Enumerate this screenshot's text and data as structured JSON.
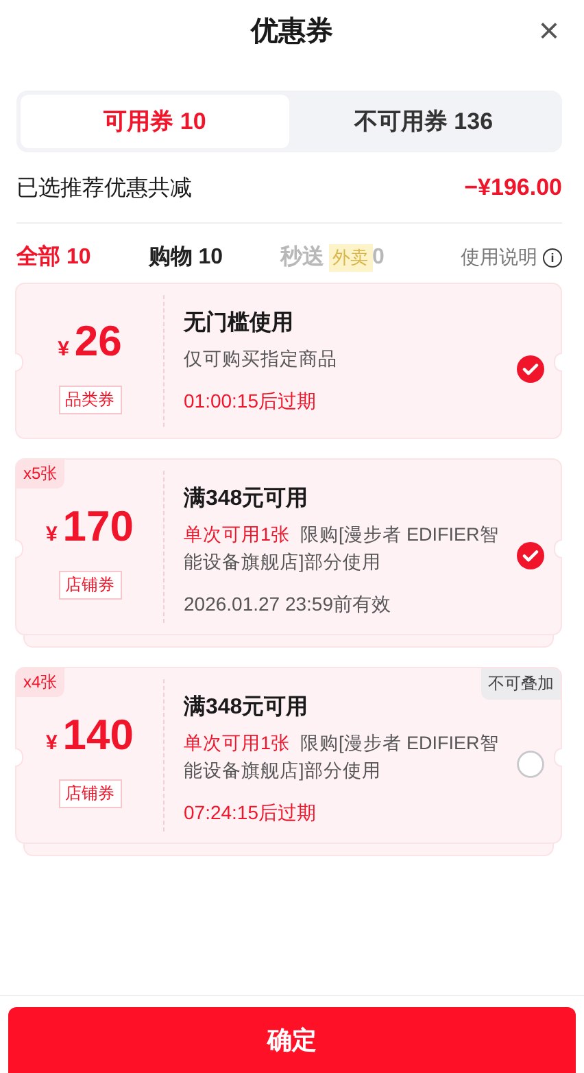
{
  "header": {
    "title": "优惠券",
    "close": "×"
  },
  "tabs": [
    {
      "label": "可用券 10",
      "selected": true
    },
    {
      "label": "不可用券 136",
      "selected": false
    }
  ],
  "summary": {
    "label": "已选推荐优惠共减",
    "amount": "−¥196.00"
  },
  "filters": [
    {
      "label": "全部",
      "count": "10",
      "selected": true,
      "disabled": false
    },
    {
      "label": "购物",
      "count": "10",
      "selected": false,
      "disabled": false
    },
    {
      "label": "秒送",
      "badge": "外卖",
      "count": "0",
      "selected": false,
      "disabled": true
    }
  ],
  "help": {
    "label": "使用说明",
    "icon": "i"
  },
  "coupons": [
    {
      "currency": "¥",
      "amount": "26",
      "type_label": "品类券",
      "title": "无门槛使用",
      "description": "仅可购买指定商品",
      "expiry": "01:00:15后过期",
      "expiry_urgent": true,
      "selected": true,
      "stacked": false
    },
    {
      "count": "x5张",
      "currency": "¥",
      "amount": "170",
      "type_label": "店铺券",
      "title": "满348元可用",
      "restriction": "单次可用1张",
      "description": "限购[漫步者 EDIFIER智能设备旗舰店]部分使用",
      "expiry": "2026.01.27 23:59前有效",
      "expiry_urgent": false,
      "selected": true,
      "stacked": true
    },
    {
      "count": "x4张",
      "currency": "¥",
      "amount": "140",
      "type_label": "店铺券",
      "title": "满348元可用",
      "restriction": "单次可用1张",
      "description": "限购[漫步者 EDIFIER智能设备旗舰店]部分使用",
      "expiry": "07:24:15后过期",
      "expiry_urgent": true,
      "selected": false,
      "stacked": true,
      "tag": "不可叠加"
    }
  ],
  "confirm": "确定"
}
